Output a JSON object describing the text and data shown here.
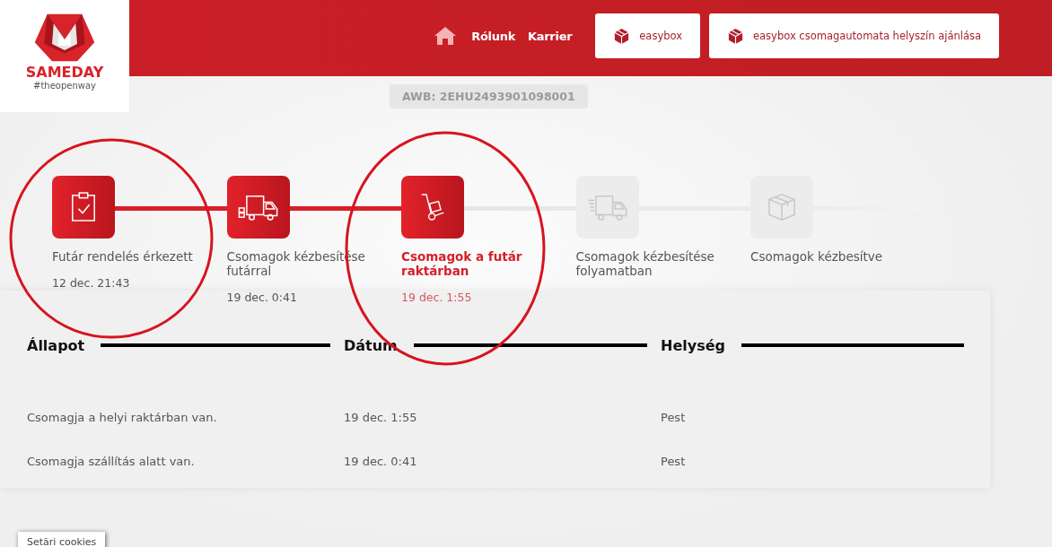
{
  "logo": {
    "name": "SAMEDAY",
    "tagline": "#theopenway"
  },
  "nav": {
    "links": [
      "Rólunk",
      "Karrier"
    ],
    "buttons": [
      "easybox",
      "easybox csomagautomata helyszín ajánlása"
    ]
  },
  "awb": "AWB: 2EHU2493901098001",
  "steps": [
    {
      "kind": "clipboard",
      "label": "Futár rendelés érkezett",
      "date": "12 dec. 21:43",
      "reached": true,
      "current": false
    },
    {
      "kind": "truck",
      "label": "Csomagok kézbesítése futárral",
      "date": "19 dec. 0:41",
      "reached": true,
      "current": false
    },
    {
      "kind": "hand-truck",
      "label": "Csomagok a futár raktárban",
      "date": "19 dec. 1:55",
      "reached": true,
      "current": true
    },
    {
      "kind": "fast-truck",
      "label": "Csomagok kézbesítése folyamatban",
      "reached": false,
      "current": false
    },
    {
      "kind": "box",
      "label": "Csomagok kézbesítve",
      "reached": false,
      "current": false
    }
  ],
  "table": {
    "columns": [
      "Állapot",
      "Dátum",
      "Helység"
    ],
    "rows": [
      [
        "Csomagja a helyi raktárban van.",
        "19 dec. 1:55",
        "Pest"
      ],
      [
        "Csomagja szállítás alatt van.",
        "19 dec. 0:41",
        "Pest"
      ]
    ]
  },
  "cookie_button": "Setări cookies"
}
